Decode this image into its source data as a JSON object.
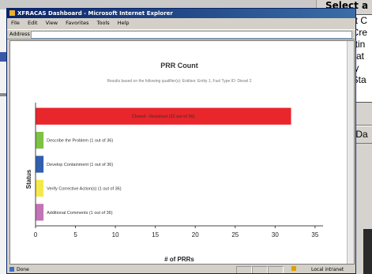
{
  "background_panel": {
    "title": "Select a",
    "list_items": [
      "Report C",
      "PRR Cre",
      "Reportin",
      "Part Cat",
      "Priority",
      "PRR Sta"
    ],
    "button_label": "Show Da"
  },
  "browser": {
    "title": "XFRACAS Dashboard - Microsoft Internet Explorer",
    "menu": [
      "File",
      "Edit",
      "View",
      "Favorites",
      "Tools",
      "Help"
    ],
    "address_label": "Address",
    "status_text": "Done",
    "zone_text": "Local intranet"
  },
  "chart_data": {
    "type": "bar",
    "orientation": "horizontal",
    "title": "PRR Count",
    "subtitle": "Results based on the following qualifier(s): Entities: Entity 1, Fuel Type ID: Diesel 2",
    "xlabel": "# of PRRs",
    "ylabel": "Status",
    "xlim": [
      0,
      36
    ],
    "xticks": [
      0,
      5,
      10,
      15,
      20,
      25,
      30,
      35
    ],
    "categories": [
      "Closed - Resolved",
      "Describe the Problem",
      "Develop Containment",
      "Verify Corrective Action(s)",
      "Additional Comments"
    ],
    "values": [
      32,
      1,
      1,
      1,
      1
    ],
    "bar_labels": [
      "Closed - Resolved (32 out of 36)",
      "Describe the Problem (1 out of 36)",
      "Develop Containment (1 out of 36)",
      "Verify Corrective Action(s) (1 out of 36)",
      "Additional Comments (1 out of 36)"
    ],
    "colors": [
      "#e8262b",
      "#7dc242",
      "#2f5fae",
      "#f5e94a",
      "#c373b6"
    ],
    "grid": false
  }
}
